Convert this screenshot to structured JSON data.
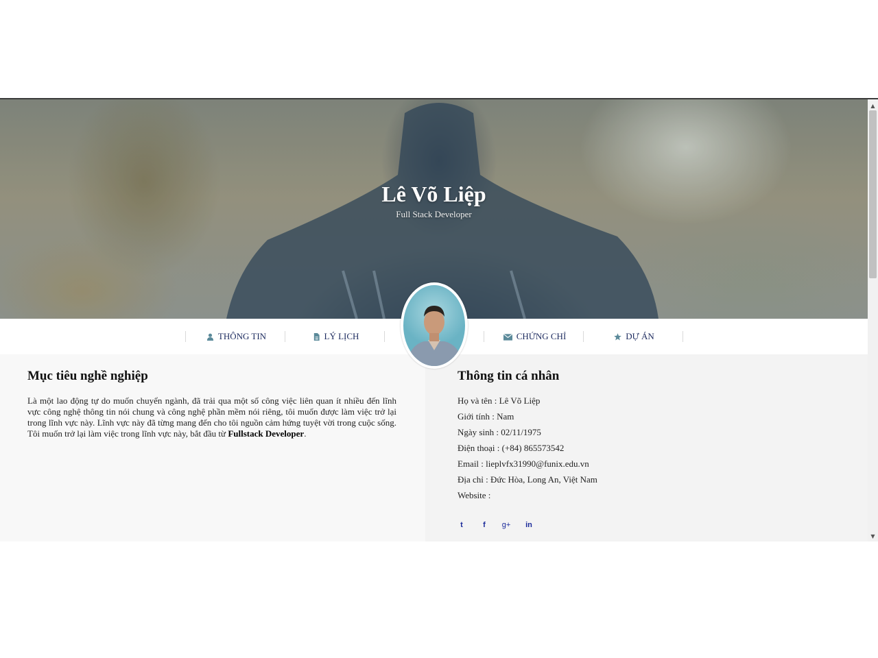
{
  "hero": {
    "name": "Lê Võ Liệp",
    "title": "Full Stack Developer"
  },
  "nav": {
    "items": [
      {
        "label": "THÔNG TIN",
        "icon": "user-icon"
      },
      {
        "label": "LÝ LỊCH",
        "icon": "file-icon"
      },
      {
        "label": "CHỨNG CHỈ",
        "icon": "envelope-icon"
      },
      {
        "label": "DỰ ÁN",
        "icon": "star-icon"
      }
    ]
  },
  "objective": {
    "heading": "Mục tiêu nghề nghiệp",
    "text": "Là một lao động tự do muốn chuyển ngành, đã trải qua một số công việc liên quan ít nhiều đến lĩnh vực công nghệ thông tin nói chung và công nghệ phần mềm nói riêng, tôi muốn được làm việc trở lại trong lĩnh vực này. Lĩnh vực này đã từng mang đến cho tôi nguồn cảm hứng tuyệt vời trong cuộc sống. Tôi muốn trở lại làm việc trong lĩnh vực này, bắt đầu từ ",
    "highlight": "Fullstack Developer",
    "end": "."
  },
  "personal": {
    "heading": "Thông tin cá nhân",
    "rows": [
      "Họ và tên : Lê Võ Liệp",
      "Giới tính : Nam",
      "Ngày sinh : 02/11/1975",
      "Điện thoại : (+84) 865573542",
      "Email : lieplvfx31990@funix.edu.vn",
      "Địa chỉ : Đức Hòa, Long An, Việt Nam",
      "Website :"
    ],
    "social": [
      {
        "icon": "twitter-icon",
        "glyph": "t"
      },
      {
        "icon": "facebook-icon",
        "glyph": "f"
      },
      {
        "icon": "google-plus-icon",
        "glyph": "g+"
      },
      {
        "icon": "linkedin-icon",
        "glyph": "in"
      }
    ]
  },
  "colors": {
    "nav_text": "#1c2a5e",
    "nav_icon": "#5b8a9a",
    "social": "#1a2a9a"
  },
  "scrollbar": {
    "up": "▲",
    "down": "▼"
  }
}
